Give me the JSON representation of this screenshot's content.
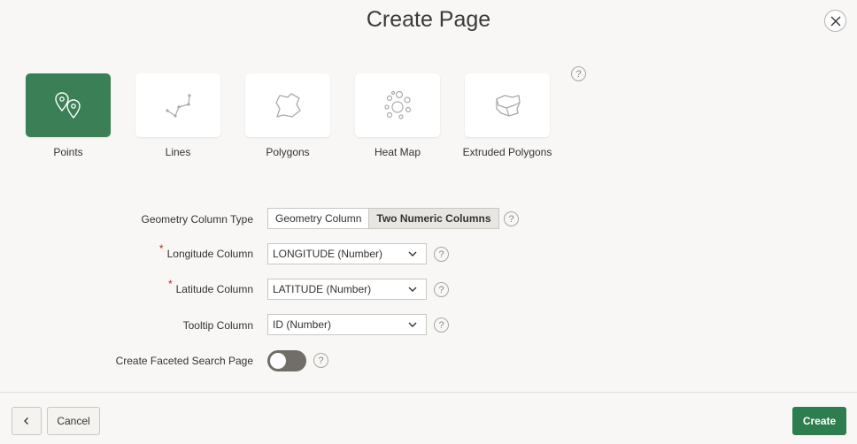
{
  "dialog": {
    "title": "Create Page",
    "close_icon": "close-icon"
  },
  "map_types": [
    {
      "label": "Points",
      "icon": "map-pins-icon",
      "selected": true
    },
    {
      "label": "Lines",
      "icon": "polyline-icon",
      "selected": false
    },
    {
      "label": "Polygons",
      "icon": "polygon-icon",
      "selected": false
    },
    {
      "label": "Heat Map",
      "icon": "heat-map-icon",
      "selected": false
    },
    {
      "label": "Extruded Polygons",
      "icon": "extruded-polygon-icon",
      "selected": false
    }
  ],
  "form": {
    "geometry_type": {
      "label": "Geometry Column Type",
      "options": [
        "Geometry Column",
        "Two Numeric Columns"
      ],
      "selected": "Two Numeric Columns"
    },
    "longitude": {
      "label": "Longitude Column",
      "required_mark": "*",
      "value": "LONGITUDE (Number)"
    },
    "latitude": {
      "label": "Latitude Column",
      "required_mark": "*",
      "value": "LATITUDE (Number)"
    },
    "tooltip": {
      "label": "Tooltip Column",
      "value": "ID (Number)"
    },
    "faceted": {
      "label": "Create Faceted Search Page",
      "on": false
    },
    "help_glyph": "?"
  },
  "footer": {
    "back_icon": "chevron-left-icon",
    "cancel_label": "Cancel",
    "create_label": "Create"
  },
  "colors": {
    "accent": "#2e7d4f",
    "selected_tile": "#3a7f55",
    "required": "#c21f1f"
  }
}
